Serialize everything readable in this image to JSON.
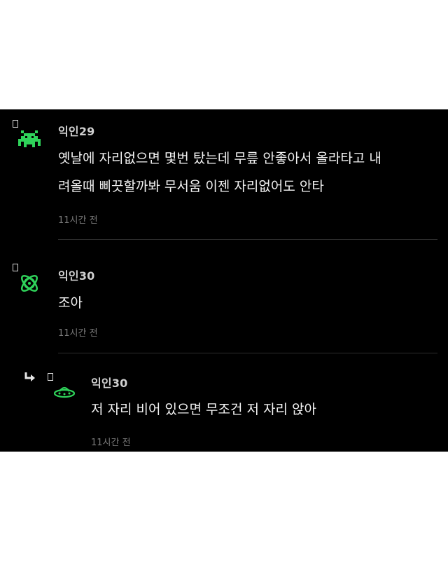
{
  "comments": [
    {
      "author": "익인29",
      "text": "옛날에 자리없으면 몇번 탔는데 무릎 안좋아서 올라타고 내\n려올때 삐끗할까봐 무서움 이젠 자리없어도 안타",
      "time": "11시간 전",
      "avatar_icon": "pixel-invader-icon",
      "avatar_color": "#2fd35a"
    },
    {
      "author": "익인30",
      "text": "조아",
      "time": "11시간 전",
      "avatar_icon": "atom-icon",
      "avatar_color": "#2fd35a"
    },
    {
      "author": "익인30",
      "text": "저 자리 비어 있으면 무조건 저 자리 앉아",
      "time": "11시간 전",
      "avatar_icon": "ufo-icon",
      "avatar_color": "#2fd35a",
      "is_reply": true,
      "reply_icon": "reply-arrow-icon"
    }
  ],
  "colors": {
    "panel_background": "#000000",
    "page_background": "#ffffff",
    "author_text": "#d0d0d0",
    "body_text": "#f2f2f2",
    "timestamp_text": "#7a7a7a",
    "divider": "#2c2c2c",
    "accent_green": "#2fd35a"
  }
}
